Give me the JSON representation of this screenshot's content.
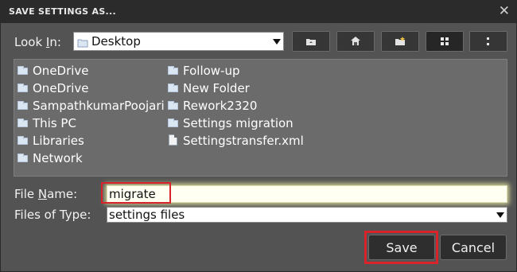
{
  "dialog": {
    "title": "SAVE SETTINGS AS...",
    "close_glyph": "✕"
  },
  "lookin": {
    "label_pre": "Look ",
    "label_accel": "I",
    "label_post": "n:",
    "value": "Desktop"
  },
  "toolbar": {
    "buttons": [
      {
        "icon": "up-folder-icon"
      },
      {
        "icon": "home-icon"
      },
      {
        "icon": "new-folder-icon"
      },
      {
        "icon": "list-view-icon",
        "active": true
      },
      {
        "icon": "details-view-icon"
      }
    ]
  },
  "files": {
    "col1": [
      {
        "name": "OneDrive",
        "icon": "folder-icon"
      },
      {
        "name": "OneDrive",
        "icon": "folder-icon"
      },
      {
        "name": "SampathkumarPoojari",
        "icon": "folder-icon"
      },
      {
        "name": "This PC",
        "icon": "folder-icon"
      },
      {
        "name": "Libraries",
        "icon": "folder-icon"
      },
      {
        "name": "Network",
        "icon": "folder-icon"
      }
    ],
    "col2": [
      {
        "name": "Follow-up",
        "icon": "folder-icon"
      },
      {
        "name": "New Folder",
        "icon": "folder-icon"
      },
      {
        "name": "Rework2320",
        "icon": "folder-icon"
      },
      {
        "name": "Settings migration",
        "icon": "folder-icon"
      },
      {
        "name": "Settingstransfer.xml",
        "icon": "document-icon"
      }
    ]
  },
  "filename": {
    "label_pre": "File ",
    "label_accel": "N",
    "label_post": "ame:",
    "value": "migrate"
  },
  "filetype": {
    "label": "Files of Type:",
    "value": "settings files"
  },
  "actions": {
    "save_label": "Save",
    "cancel_label": "Cancel"
  },
  "colors": {
    "highlight": "#d8232a",
    "dialog_bg": "#535353",
    "titlebar_bg": "#2b2b2b"
  }
}
